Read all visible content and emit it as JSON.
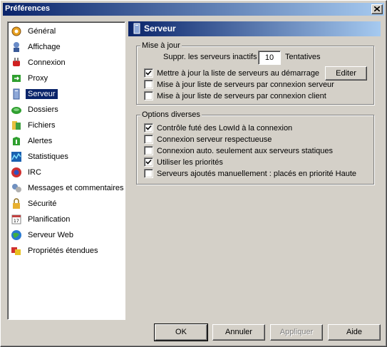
{
  "window": {
    "title": "Préférences",
    "close_icon": "close-icon"
  },
  "sidebar": {
    "items": [
      {
        "label": "Général",
        "icon": "general-icon"
      },
      {
        "label": "Affichage",
        "icon": "display-icon"
      },
      {
        "label": "Connexion",
        "icon": "connection-icon"
      },
      {
        "label": "Proxy",
        "icon": "proxy-icon"
      },
      {
        "label": "Serveur",
        "icon": "server-icon",
        "selected": true
      },
      {
        "label": "Dossiers",
        "icon": "folders-icon"
      },
      {
        "label": "Fichiers",
        "icon": "files-icon"
      },
      {
        "label": "Alertes",
        "icon": "alerts-icon"
      },
      {
        "label": "Statistiques",
        "icon": "statistics-icon"
      },
      {
        "label": "IRC",
        "icon": "irc-icon"
      },
      {
        "label": "Messages et commentaires",
        "icon": "messages-icon"
      },
      {
        "label": "Sécurité",
        "icon": "security-icon"
      },
      {
        "label": "Planification",
        "icon": "scheduler-icon"
      },
      {
        "label": "Serveur Web",
        "icon": "web-server-icon"
      },
      {
        "label": "Propriétés étendues",
        "icon": "extended-properties-icon"
      }
    ]
  },
  "panel": {
    "title": "Serveur"
  },
  "update_group": {
    "legend": "Mise à jour",
    "remove_label": "Suppr. les serveurs inactifs",
    "remove_value": "10",
    "attempts_label": "Tentatives",
    "edit_button": "Editer",
    "options": [
      {
        "label": "Mettre à jour la liste de serveurs au démarrage",
        "checked": true
      },
      {
        "label": "Mise à jour liste de serveurs par connexion serveur",
        "checked": false
      },
      {
        "label": "Mise à jour liste de serveurs par connexion client",
        "checked": false
      }
    ]
  },
  "misc_group": {
    "legend": "Options diverses",
    "options": [
      {
        "label": "Contrôle futé des LowId à la connexion",
        "checked": true
      },
      {
        "label": "Connexion serveur respectueuse",
        "checked": false
      },
      {
        "label": "Connexion auto. seulement aux serveurs statiques",
        "checked": false
      },
      {
        "label": "Utiliser les priorités",
        "checked": true
      },
      {
        "label": "Serveurs ajoutés manuellement : placés en priorité Haute",
        "checked": false
      }
    ]
  },
  "buttons": {
    "ok": "OK",
    "cancel": "Annuler",
    "apply": "Appliquer",
    "help": "Aide"
  },
  "colors": {
    "selection": "#0a246a",
    "face": "#d4d0c8",
    "title_gradient_end": "#a6caf0"
  }
}
